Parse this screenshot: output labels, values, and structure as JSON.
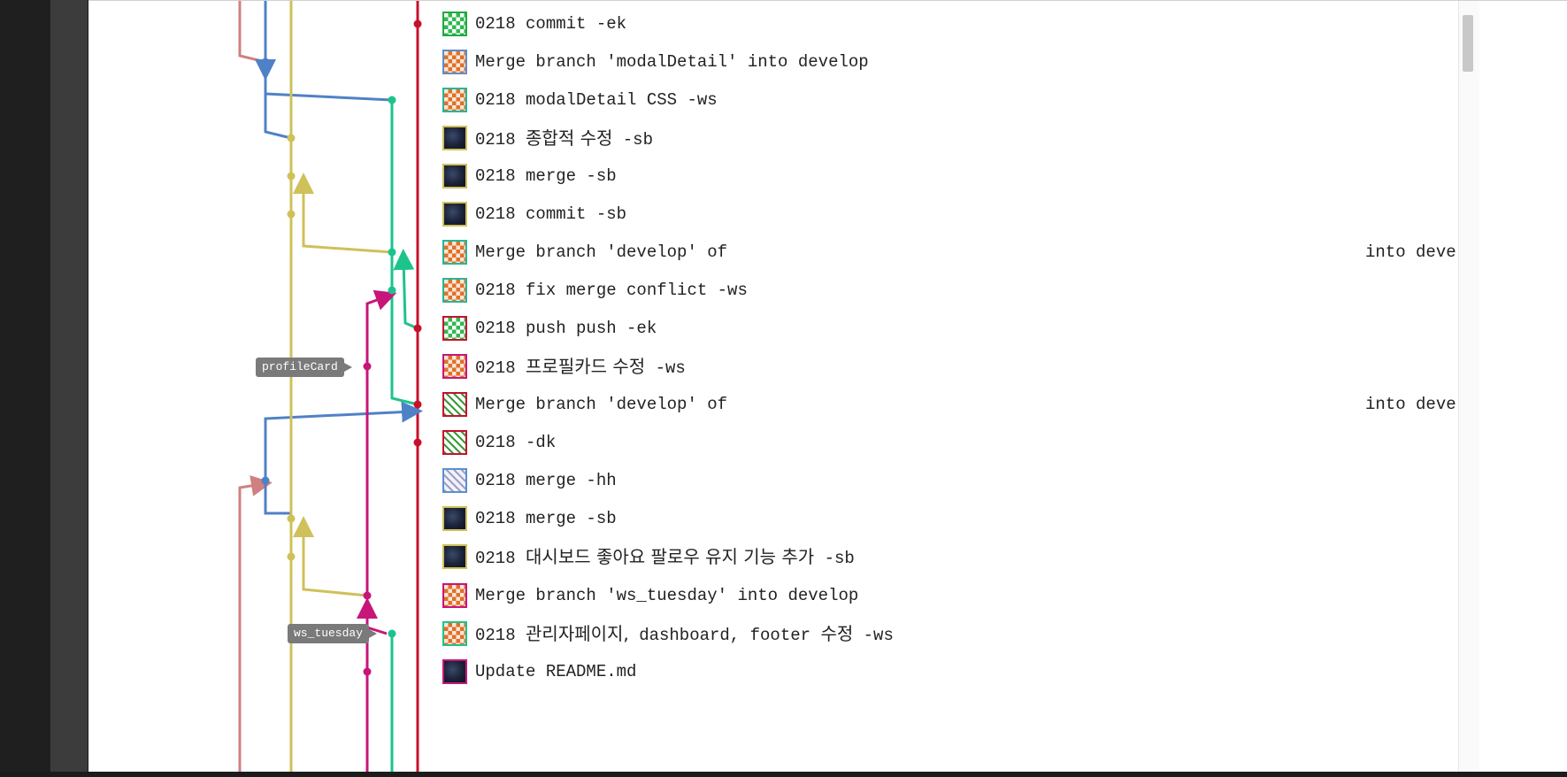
{
  "colors": {
    "red": "#c8102e",
    "salmon": "#d08080",
    "blue": "#4f81c7",
    "yellow": "#cfc05a",
    "green": "#1cc48c",
    "magenta": "#c8157a"
  },
  "branch_tags": [
    {
      "label": "profileCard"
    },
    {
      "label": "ws_tuesday"
    }
  ],
  "commits": [
    {
      "prefix": "0218",
      "message": "commit -ek",
      "author_icon": "identicon-green",
      "border": "#22a844"
    },
    {
      "prefix": "",
      "message": "Merge branch 'modalDetail' into develop",
      "author_icon": "identicon-orange",
      "border": "#5a8fd0"
    },
    {
      "prefix": "0218",
      "message": "modalDetail CSS -ws",
      "author_icon": "identicon-orange",
      "border": "#22b89a"
    },
    {
      "prefix": "0218",
      "message_kr": "종합적 수정",
      "message": "-sb",
      "author_icon": "dark-photo",
      "border": "#cfc05a"
    },
    {
      "prefix": "0218",
      "message": "merge -sb",
      "author_icon": "dark-photo",
      "border": "#cfc05a"
    },
    {
      "prefix": "0218",
      "message": "commit -sb",
      "author_icon": "dark-photo",
      "border": "#cfc05a"
    },
    {
      "prefix": "",
      "message": "Merge branch 'develop' of",
      "tail": "into deve",
      "author_icon": "identicon-orange",
      "border": "#22b89a"
    },
    {
      "prefix": "0218",
      "message": "fix merge conflict -ws",
      "author_icon": "identicon-orange",
      "border": "#22b89a"
    },
    {
      "prefix": "0218",
      "message": "push push -ek",
      "author_icon": "identicon-green",
      "border": "#c8102e"
    },
    {
      "prefix": "0218",
      "message_kr": "프로필카드 수정",
      "message": "-ws",
      "author_icon": "identicon-orange",
      "border": "#c8157a"
    },
    {
      "prefix": "",
      "message": "Merge branch 'develop' of",
      "tail": "into deve",
      "author_icon": "identicon-lattice",
      "border": "#c8102e"
    },
    {
      "prefix": "0218",
      "message": "-dk",
      "author_icon": "identicon-lattice",
      "border": "#c8102e"
    },
    {
      "prefix": "0218",
      "message": "merge -hh",
      "author_icon": "identicon-lavender",
      "border": "#5a8fd0"
    },
    {
      "prefix": "0218",
      "message": "merge -sb",
      "author_icon": "dark-photo",
      "border": "#cfc05a"
    },
    {
      "prefix": "0218",
      "message_kr": "대시보드 좋아요 팔로우 유지 기능 추가",
      "message": "-sb",
      "author_icon": "dark-photo",
      "border": "#cfc05a"
    },
    {
      "prefix": "",
      "message": "Merge branch 'ws_tuesday' into develop",
      "author_icon": "identicon-orange",
      "border": "#c8157a"
    },
    {
      "prefix": "0218",
      "message_kr": "관리자페이지,",
      "message": "dashboard, footer",
      "message_kr2": "수정",
      "message2": "-ws",
      "author_icon": "identicon-orange",
      "border": "#1cc48c"
    },
    {
      "prefix": "",
      "message": "Update README.md",
      "author_icon": "dark-photo",
      "border": "#c8157a"
    }
  ]
}
